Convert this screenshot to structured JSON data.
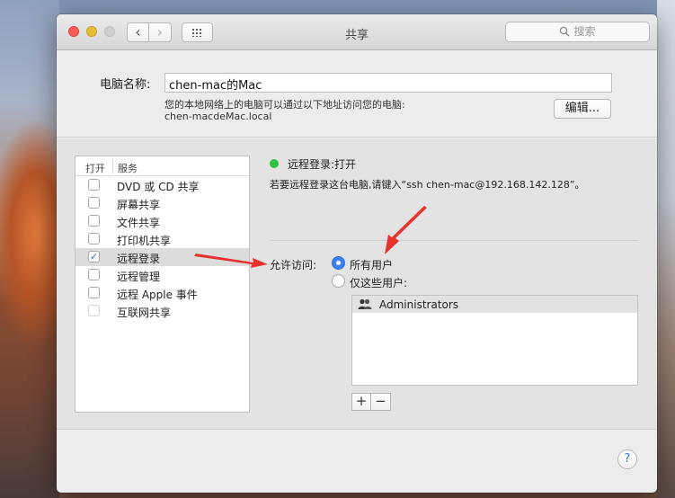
{
  "window": {
    "title": "共享",
    "back_glyph": "‹",
    "forward_glyph": "›",
    "search_placeholder": "搜索"
  },
  "computer": {
    "name_label": "电脑名称:",
    "name_value": "chen-mac的Mac",
    "local_desc": "您的本地网络上的电脑可以通过以下地址访问您的电脑:",
    "local_address": "chen-macdeMac.local",
    "edit_button": "编辑..."
  },
  "services": {
    "col_on": "打开",
    "col_service": "服务",
    "items": [
      {
        "label": "DVD 或 CD 共享",
        "checked": false,
        "selected": false
      },
      {
        "label": "屏幕共享",
        "checked": false,
        "selected": false
      },
      {
        "label": "文件共享",
        "checked": false,
        "selected": false
      },
      {
        "label": "打印机共享",
        "checked": false,
        "selected": false
      },
      {
        "label": "远程登录",
        "checked": true,
        "selected": true
      },
      {
        "label": "远程管理",
        "checked": false,
        "selected": false
      },
      {
        "label": "远程 Apple 事件",
        "checked": false,
        "selected": false
      },
      {
        "label": "互联网共享",
        "checked": false,
        "selected": false
      }
    ]
  },
  "detail": {
    "status": "远程登录:打开",
    "status_color": "#2bc340",
    "hint": "若要远程登录这台电脑,请键入“ssh chen-mac@192.168.142.128”。",
    "allow_label": "允许访问:",
    "option_all": "所有用户",
    "option_only": "仅这些用户:",
    "selected_option": "所有用户",
    "users": [
      "Administrators"
    ],
    "add_glyph": "+",
    "remove_glyph": "−"
  },
  "help_glyph": "?",
  "colors": {
    "accent": "#3b82f6",
    "arrow": "#e8312f"
  }
}
